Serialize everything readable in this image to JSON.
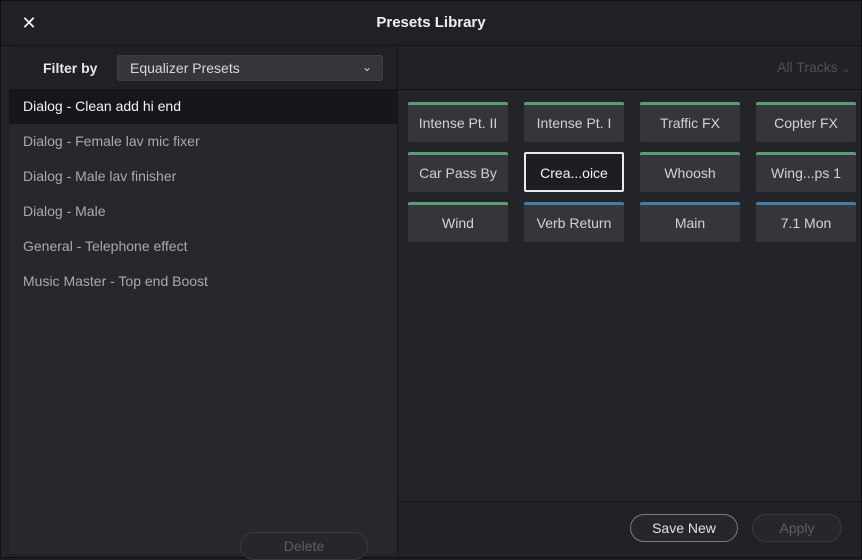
{
  "window": {
    "title": "Presets Library",
    "close_icon": "close-icon"
  },
  "filter": {
    "label": "Filter by",
    "selected": "Equalizer Presets"
  },
  "presets": [
    {
      "label": "Dialog - Clean add hi end",
      "selected": true
    },
    {
      "label": "Dialog - Female lav mic fixer",
      "selected": false
    },
    {
      "label": "Dialog - Male lav finisher",
      "selected": false
    },
    {
      "label": "Dialog - Male",
      "selected": false
    },
    {
      "label": "General - Telephone effect",
      "selected": false
    },
    {
      "label": "Music Master - Top end Boost",
      "selected": false
    }
  ],
  "left_footer": {
    "delete_label": "Delete"
  },
  "tracks": {
    "selected": "All Tracks"
  },
  "tiles": [
    {
      "label": "Intense Pt. II",
      "strip": "#5e9c73"
    },
    {
      "label": "Intense Pt. I",
      "strip": "#5e9c73"
    },
    {
      "label": "Traffic FX",
      "strip": "#5e9c73"
    },
    {
      "label": "Copter FX",
      "strip": "#5e9c73"
    },
    {
      "label": "Car Pass By",
      "strip": "#5e9c73"
    },
    {
      "label": "Crea...oice",
      "strip": "#5e9c73",
      "selected": true
    },
    {
      "label": "Whoosh",
      "strip": "#5e9c73"
    },
    {
      "label": "Wing...ps 1",
      "strip": "#5e9c73"
    },
    {
      "label": "Wind",
      "strip": "#5e9c73"
    },
    {
      "label": "Verb Return",
      "strip": "#3f7fa8"
    },
    {
      "label": "Main",
      "strip": "#3f7fa8"
    },
    {
      "label": "7.1 Mon",
      "strip": "#3f7fa8"
    }
  ],
  "right_footer": {
    "save_new_label": "Save New",
    "apply_label": "Apply"
  }
}
